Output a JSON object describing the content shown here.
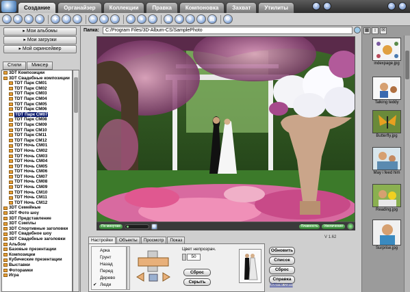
{
  "menu": {
    "tabs": [
      "Создание",
      "Органайзер",
      "Коллекции",
      "Правка",
      "Компоновка",
      "Захват",
      "Утилиты"
    ],
    "active": "Создание"
  },
  "albums": {
    "my_albums": "Мои альбомы",
    "my_downloads": "Мои загрузки",
    "my_screensaver": "Мой скринсейвер"
  },
  "lefttabs": [
    "Стили",
    "Миксер"
  ],
  "tree": [
    "3DT Композиции",
    "3DT Свадебные композиции",
    "TDT Парк СМ01",
    "TDT Парк СМ02",
    "TDT Парк СМ03",
    "TDT Парк СМ04",
    "TDT Парк СМ05",
    "TDT Парк СМ06",
    "TDT Парк СМ07",
    "TDT Парк СМ08",
    "TDT Парк СМ09",
    "TDT Парк СМ10",
    "TDT Парк СМ11",
    "TDT Парк СМ12",
    "TDT Ночь СМ01",
    "TDT Ночь СМ02",
    "TDT Ночь СМ03",
    "TDT Ночь СМ04",
    "TDT Ночь СМ05",
    "TDT Ночь СМ06",
    "TDT Ночь СМ07",
    "TDT Ночь СМ08",
    "TDT Ночь СМ09",
    "TDT Ночь СМ10",
    "TDT Ночь СМ11",
    "TDT Ночь СМ12",
    "3DT Семейные",
    "3DT Фото шоу",
    "3DT Представление",
    "3DT Сэмплы",
    "3DT Спортивные заголовки",
    "3DT Свадебное шоу",
    "3DT Свадебные заголовки",
    "Альбом",
    "Базовые презентации",
    "Композиции",
    "Кубические презентации",
    "Выставки",
    "Фоторамки",
    "Игра"
  ],
  "tree_selected": "TDT Парк СМ07",
  "folder": {
    "label": "Папка:",
    "path": "C:/Program Files/3D-Album-CS/SamplePhoto"
  },
  "controls": {
    "by_time": "По минутам",
    "smooth": "Плавность",
    "zoom": "Увеличение"
  },
  "version": "V 1.62",
  "bottom_tabs": [
    "Настройки",
    "Объекты",
    "Просмотр",
    "Показ"
  ],
  "options": [
    "Арка",
    "Грунт",
    "Назад",
    "Перед",
    "Дерево",
    "Люди"
  ],
  "checked_option": "Люди",
  "opacity": {
    "label": "Цвет непрозрач.",
    "value": "50"
  },
  "buttons": {
    "reset1": "Сброс",
    "hide": "Скрыть",
    "refresh": "Обновить",
    "list": "Список",
    "reset2": "Сброс",
    "help": "Справка"
  },
  "link": "3dtime.com",
  "thumbnails": [
    {
      "caption": "indexpage.jpg"
    },
    {
      "caption": "Talking teddy"
    },
    {
      "caption": "Butterfly.jpg"
    },
    {
      "caption": "May i feed him"
    },
    {
      "caption": "Reading.jpg"
    },
    {
      "caption": "Surprise.jpg"
    }
  ],
  "colors": {
    "accent": "#0a1a6e",
    "link": "#1a2a9c",
    "control_green": "#2c7a2c"
  }
}
